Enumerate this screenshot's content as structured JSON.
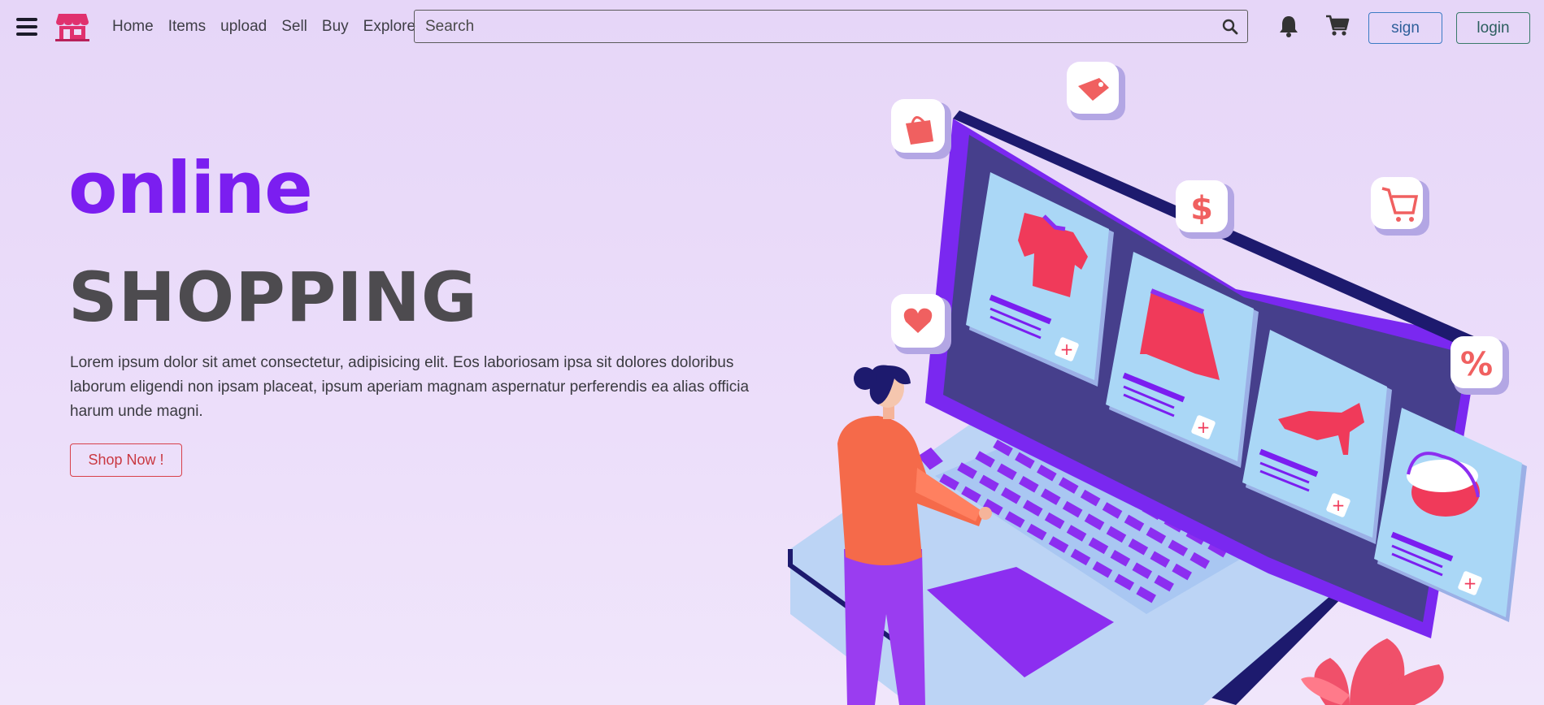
{
  "navbar": {
    "menu_icon": "hamburger-menu-icon",
    "logo_icon": "store-icon",
    "links": [
      "Home",
      "Items",
      "upload",
      "Sell",
      "Buy",
      "Explore"
    ],
    "search": {
      "placeholder": "Search",
      "value": ""
    },
    "search_icon": "search-icon",
    "bell_icon": "bell-icon",
    "cart_icon": "cart-icon",
    "sign_label": "sign",
    "login_label": "login"
  },
  "hero": {
    "title_line1": "online",
    "title_line2": "SHOPPING",
    "description": "Lorem ipsum dolor sit amet consectetur, adipisicing elit. Eos laboriosam ipsa sit dolores doloribus laborum eligendi non ipsam placeat, ipsum aperiam magnam aspernatur perferendis ea alias officia harum unde magni.",
    "cta_label": "Shop Now !"
  },
  "colors": {
    "accent": "#7b1ef0",
    "brand": "#e0316e",
    "cta": "#d8404a"
  }
}
